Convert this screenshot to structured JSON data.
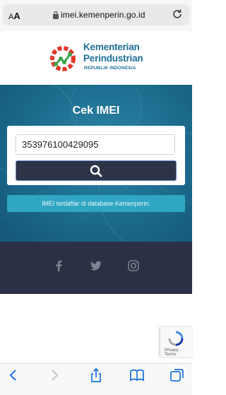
{
  "browser": {
    "aa_small": "A",
    "aa_big": "A",
    "url": "imei.kemenperin.go.id"
  },
  "logo": {
    "line1": "Kementerian",
    "line2": "Perindustrian",
    "line3": "REPUBLIK INDONESIA"
  },
  "page": {
    "title": "Cek IMEI",
    "imei_value": "353976100429095",
    "result_text": "IMEI terdaftar di database Kemenperin."
  },
  "recaptcha": {
    "links": "Privacy - Terms"
  },
  "colors": {
    "hero": "#1b6a8c",
    "footer": "#2b3044",
    "button": "#2d3447",
    "result": "#2fa6c2",
    "brand": "#1d6f95"
  },
  "icons": [
    "lock-icon",
    "reload-icon",
    "search-icon",
    "facebook-icon",
    "twitter-icon",
    "instagram-icon",
    "back-icon",
    "forward-icon",
    "share-icon",
    "bookmarks-icon",
    "tabs-icon",
    "recaptcha-icon"
  ]
}
